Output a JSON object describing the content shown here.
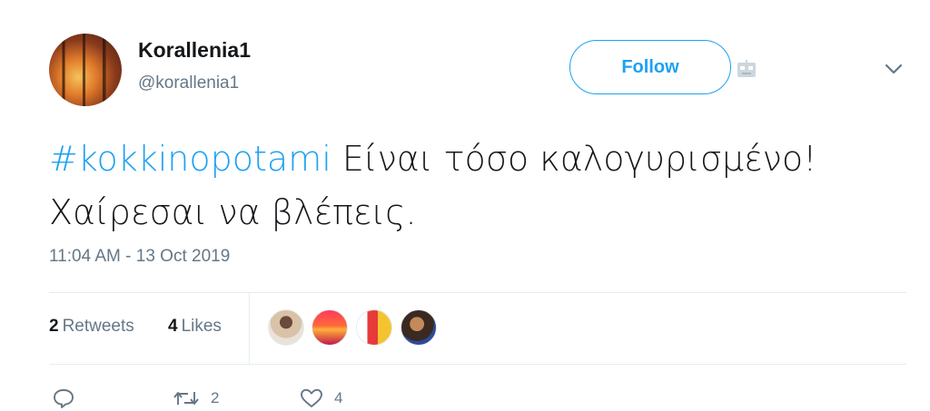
{
  "user": {
    "display_name": "Korallenia1",
    "handle": "@korallenia1"
  },
  "header": {
    "follow_label": "Follow",
    "more_icon": "chevron-down-icon",
    "bot_icon": "robot-icon"
  },
  "tweet": {
    "hashtag": "#kokkinopotami",
    "text_rest": " Είναι τόσο καλογυρισμένο! Χαίρεσαι να βλέπεις."
  },
  "timestamp": "11:04 AM - 13 Oct 2019",
  "stats": {
    "retweets_count": "2",
    "retweets_label": "Retweets",
    "likes_count": "4",
    "likes_label": "Likes"
  },
  "actions": {
    "reply_icon": "reply-icon",
    "retweet_icon": "retweet-icon",
    "retweet_count": "2",
    "like_icon": "heart-icon",
    "like_count": "4"
  },
  "colors": {
    "accent": "#1da1f2",
    "muted_text": "#657786",
    "primary_text": "#14171a",
    "divider": "#e6ecf0"
  }
}
